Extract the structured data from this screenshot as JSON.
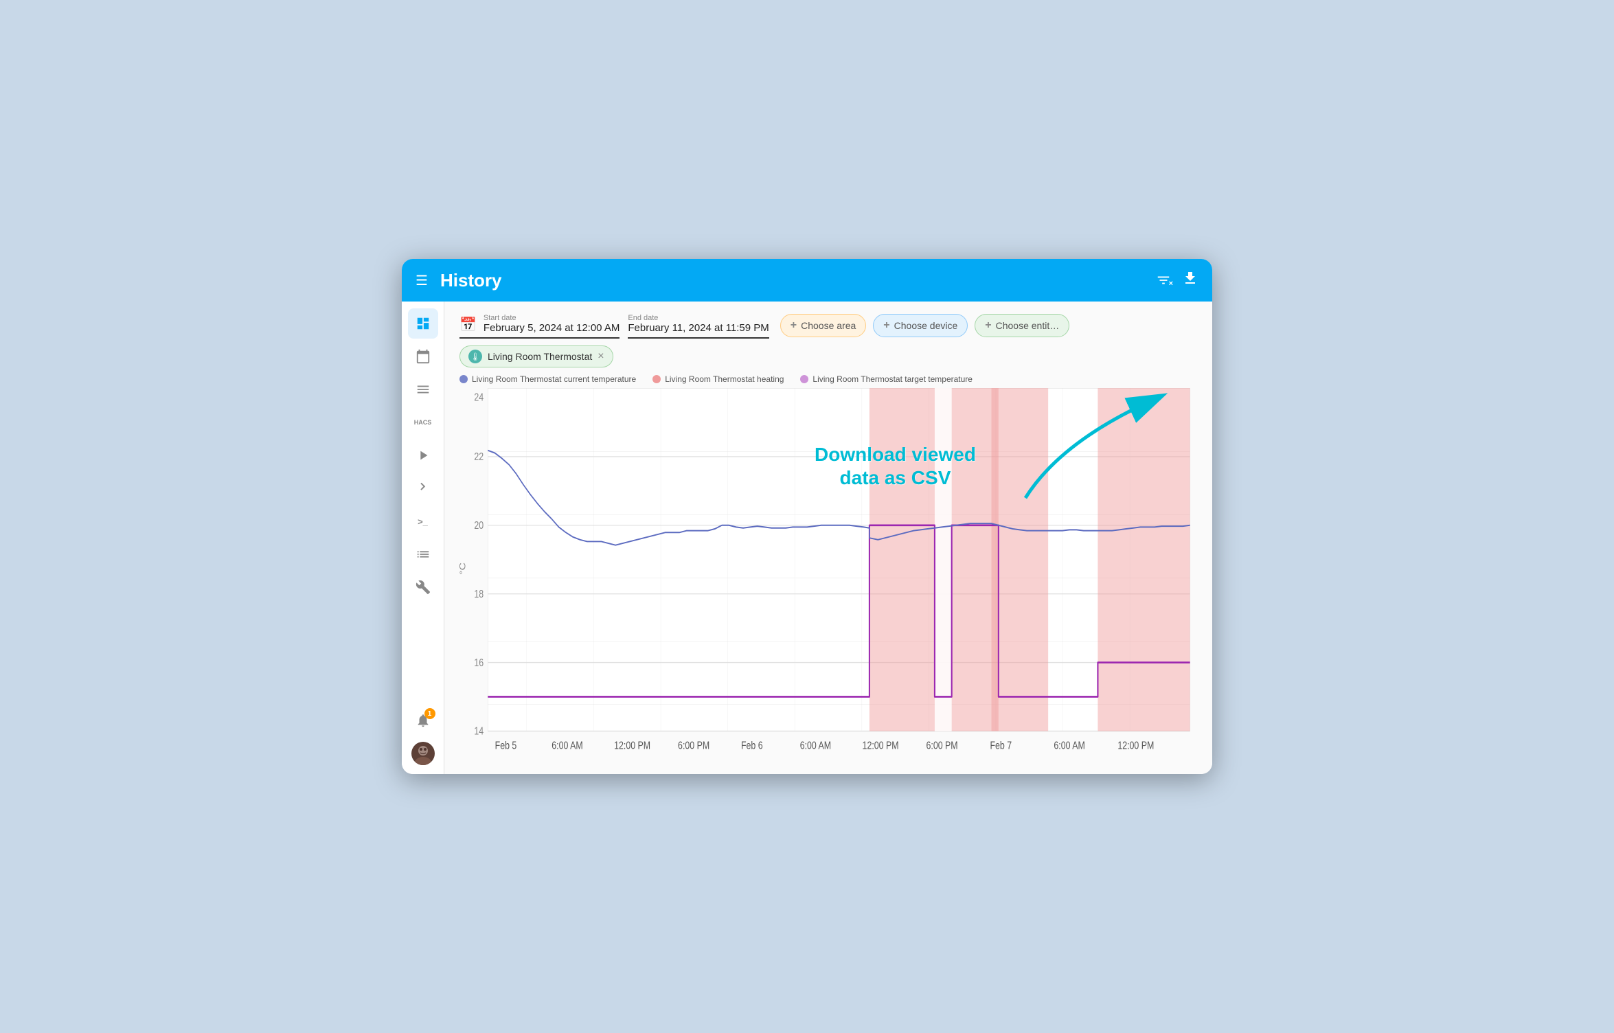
{
  "topbar": {
    "title": "History",
    "menu_icon": "☰",
    "filter_icon": "⧩",
    "download_icon": "⬇"
  },
  "sidebar": {
    "items": [
      {
        "id": "dashboard",
        "icon": "📊",
        "active": true
      },
      {
        "id": "calendar",
        "icon": "📅",
        "active": false
      },
      {
        "id": "logbook",
        "icon": "≡",
        "active": false
      },
      {
        "id": "hacs",
        "icon": "HACS",
        "active": false,
        "text": true
      },
      {
        "id": "media",
        "icon": "▶",
        "active": false
      },
      {
        "id": "vscode",
        "icon": "◁",
        "active": false
      },
      {
        "id": "terminal",
        "icon": ">_",
        "active": false,
        "text": true
      },
      {
        "id": "todo",
        "icon": "📋",
        "active": false
      },
      {
        "id": "tools",
        "icon": "🔧",
        "active": false
      }
    ],
    "notification_count": "1",
    "avatar_initial": "👤"
  },
  "date_filters": {
    "start_label": "Start date",
    "start_value": "February 5, 2024 at 12:00 AM",
    "end_label": "End date",
    "end_value": "February 11, 2024 at 11:59 PM"
  },
  "chips": {
    "area_label": "Choose area",
    "device_label": "Choose device",
    "entity_label": "Choose entit…"
  },
  "active_filter": {
    "label": "Living Room Thermostat"
  },
  "legend": {
    "items": [
      {
        "color": "#7986cb",
        "label": "Living Room Thermostat current temperature"
      },
      {
        "color": "#ef9a9a",
        "label": "Living Room Thermostat heating"
      },
      {
        "color": "#ce93d8",
        "label": "Living Room Thermostat target temperature"
      }
    ]
  },
  "annotation": {
    "line1": "Download viewed",
    "line2": "data as CSV"
  },
  "chart": {
    "x_labels": [
      "Feb 5",
      "6:00 AM",
      "12:00 PM",
      "6:00 PM",
      "Feb 6",
      "6:00 AM",
      "12:00 PM",
      "6:00 PM",
      "Feb 7",
      "6:00 AM",
      "12:00 PM"
    ],
    "y_labels": [
      "14",
      "16",
      "18",
      "20",
      "22",
      "24"
    ],
    "y_axis_label": "°C"
  }
}
